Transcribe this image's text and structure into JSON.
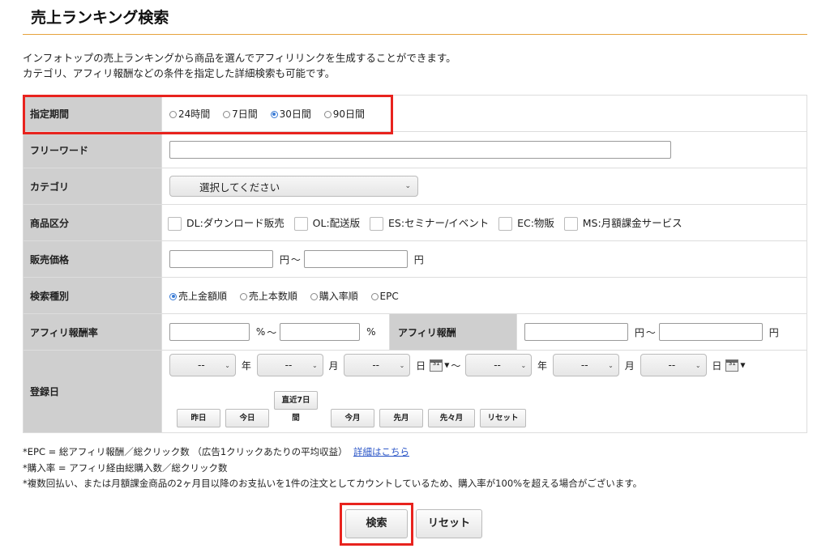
{
  "page": {
    "title": "売上ランキング検索",
    "intro_line1": "インフォトップの売上ランキングから商品を選んでアフィリリンクを生成することができます。",
    "intro_line2": "カテゴリ、アフィリ報酬などの条件を指定した詳細検索も可能です。"
  },
  "form": {
    "period": {
      "label": "指定期間",
      "options": [
        "24時間",
        "7日間",
        "30日間",
        "90日間"
      ],
      "selected": "30日間"
    },
    "keyword": {
      "label": "フリーワード",
      "value": ""
    },
    "category": {
      "label": "カテゴリ",
      "selected": "選択してください"
    },
    "product_type": {
      "label": "商品区分",
      "options": [
        "DL:ダウンロード販売",
        "OL:配送版",
        "ES:セミナー/イベント",
        "EC:物販",
        "MS:月額課金サービス"
      ]
    },
    "price": {
      "label": "販売価格",
      "unit": "円",
      "tilde": "〜"
    },
    "sort": {
      "label": "検索種別",
      "options": [
        "売上金額順",
        "売上本数順",
        "購入率順",
        "EPC"
      ],
      "selected": "売上金額順"
    },
    "affiliate_rate": {
      "label": "アフィリ報酬率",
      "unit": "%",
      "tilde": "〜"
    },
    "affiliate_reward": {
      "label": "アフィリ報酬",
      "unit": "円",
      "tilde": "〜"
    },
    "reg_date": {
      "label": "登録日",
      "placeholder": "--",
      "year": "年",
      "month": "月",
      "day": "日",
      "tilde": "〜",
      "cal_icon_text": "31",
      "buttons": {
        "yesterday": "昨日",
        "today": "今日",
        "last7_line1": "直近7日",
        "last7_line2": "間",
        "this_month": "今月",
        "last_month": "先月",
        "two_months_ago": "先々月",
        "reset": "リセット"
      }
    }
  },
  "notes": {
    "epc": "*EPC = 総アフィリ報酬／総クリック数 （広告1クリックあたりの平均収益）",
    "epc_link": "詳細はこちら",
    "rate": "*購入率 = アフィリ経由総購入数／総クリック数",
    "multi": "*複数回払い、または月額課金商品の2ヶ月目以降のお支払いを1件の注文としてカウントしているため、購入率が100%を超える場合がございます。"
  },
  "actions": {
    "search": "検索",
    "reset": "リセット"
  },
  "colors": {
    "title_rule": "#e6a23c",
    "label_bg": "#cfcfcf",
    "highlight": "#e8231e",
    "radio_selected": "#3a7bd5",
    "link": "#2a55c7"
  }
}
